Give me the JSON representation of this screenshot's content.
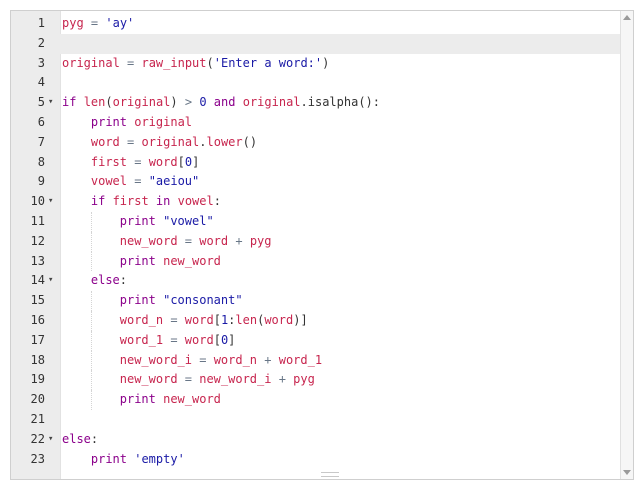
{
  "editor": {
    "language": "python",
    "active_line": 2,
    "colors": {
      "keyword": "#8b008b",
      "string": "#1a1aa6",
      "variable": "#c7254e",
      "gutter_bg": "#ececec"
    },
    "lines": [
      {
        "num": "1",
        "fold": "",
        "indent": 0,
        "tokens": [
          [
            "pyg",
            "var"
          ],
          [
            " = ",
            "op"
          ],
          [
            "'ay'",
            "str"
          ]
        ]
      },
      {
        "num": "2",
        "fold": "",
        "indent": 0,
        "tokens": []
      },
      {
        "num": "3",
        "fold": "",
        "indent": 0,
        "tokens": [
          [
            "original",
            "var"
          ],
          [
            " = ",
            "op"
          ],
          [
            "raw_input",
            "var"
          ],
          [
            "(",
            "plain"
          ],
          [
            "'Enter a word:'",
            "str"
          ],
          [
            ")",
            "plain"
          ]
        ]
      },
      {
        "num": "4",
        "fold": "",
        "indent": 0,
        "tokens": []
      },
      {
        "num": "5",
        "fold": "▾",
        "indent": 0,
        "tokens": [
          [
            "if",
            "kw"
          ],
          [
            " ",
            "plain"
          ],
          [
            "len",
            "var"
          ],
          [
            "(",
            "plain"
          ],
          [
            "original",
            "var"
          ],
          [
            ") ",
            "plain"
          ],
          [
            ">",
            "op"
          ],
          [
            " ",
            "plain"
          ],
          [
            "0",
            "num"
          ],
          [
            " ",
            "plain"
          ],
          [
            "and",
            "kw"
          ],
          [
            " ",
            "plain"
          ],
          [
            "original",
            "var"
          ],
          [
            ".isalpha():",
            "plain"
          ]
        ]
      },
      {
        "num": "6",
        "fold": "",
        "indent": 1,
        "tokens": [
          [
            "print",
            "kw"
          ],
          [
            " ",
            "plain"
          ],
          [
            "original",
            "var"
          ]
        ]
      },
      {
        "num": "7",
        "fold": "",
        "indent": 1,
        "tokens": [
          [
            "word",
            "var"
          ],
          [
            " = ",
            "op"
          ],
          [
            "original",
            "var"
          ],
          [
            ".",
            "plain"
          ],
          [
            "lower",
            "var"
          ],
          [
            "()",
            "plain"
          ]
        ]
      },
      {
        "num": "8",
        "fold": "",
        "indent": 1,
        "tokens": [
          [
            "first",
            "var"
          ],
          [
            " = ",
            "op"
          ],
          [
            "word",
            "var"
          ],
          [
            "[",
            "plain"
          ],
          [
            "0",
            "num"
          ],
          [
            "]",
            "plain"
          ]
        ]
      },
      {
        "num": "9",
        "fold": "",
        "indent": 1,
        "tokens": [
          [
            "vowel",
            "var"
          ],
          [
            " = ",
            "op"
          ],
          [
            "\"aeiou\"",
            "str"
          ]
        ]
      },
      {
        "num": "10",
        "fold": "▾",
        "indent": 1,
        "tokens": [
          [
            "if",
            "kw"
          ],
          [
            " ",
            "plain"
          ],
          [
            "first",
            "var"
          ],
          [
            " ",
            "plain"
          ],
          [
            "in",
            "kw"
          ],
          [
            " ",
            "plain"
          ],
          [
            "vowel",
            "var"
          ],
          [
            ":",
            "plain"
          ]
        ]
      },
      {
        "num": "11",
        "fold": "",
        "indent": 2,
        "tokens": [
          [
            "print",
            "kw"
          ],
          [
            " ",
            "plain"
          ],
          [
            "\"vowel\"",
            "str"
          ]
        ]
      },
      {
        "num": "12",
        "fold": "",
        "indent": 2,
        "tokens": [
          [
            "new_word",
            "var"
          ],
          [
            " = ",
            "op"
          ],
          [
            "word",
            "var"
          ],
          [
            " + ",
            "op"
          ],
          [
            "pyg",
            "var"
          ]
        ]
      },
      {
        "num": "13",
        "fold": "",
        "indent": 2,
        "tokens": [
          [
            "print",
            "kw"
          ],
          [
            " ",
            "plain"
          ],
          [
            "new_word",
            "var"
          ]
        ]
      },
      {
        "num": "14",
        "fold": "▾",
        "indent": 1,
        "tokens": [
          [
            "else",
            "kw"
          ],
          [
            ":",
            "plain"
          ]
        ]
      },
      {
        "num": "15",
        "fold": "",
        "indent": 2,
        "tokens": [
          [
            "print",
            "kw"
          ],
          [
            " ",
            "plain"
          ],
          [
            "\"consonant\"",
            "str"
          ]
        ]
      },
      {
        "num": "16",
        "fold": "",
        "indent": 2,
        "tokens": [
          [
            "word_n",
            "var"
          ],
          [
            " = ",
            "op"
          ],
          [
            "word",
            "var"
          ],
          [
            "[",
            "plain"
          ],
          [
            "1",
            "num"
          ],
          [
            ":",
            "plain"
          ],
          [
            "len",
            "var"
          ],
          [
            "(",
            "plain"
          ],
          [
            "word",
            "var"
          ],
          [
            ")]",
            "plain"
          ]
        ]
      },
      {
        "num": "17",
        "fold": "",
        "indent": 2,
        "tokens": [
          [
            "word_1",
            "var"
          ],
          [
            " = ",
            "op"
          ],
          [
            "word",
            "var"
          ],
          [
            "[",
            "plain"
          ],
          [
            "0",
            "num"
          ],
          [
            "]",
            "plain"
          ]
        ]
      },
      {
        "num": "18",
        "fold": "",
        "indent": 2,
        "tokens": [
          [
            "new_word_i",
            "var"
          ],
          [
            " = ",
            "op"
          ],
          [
            "word_n",
            "var"
          ],
          [
            " + ",
            "op"
          ],
          [
            "word_1",
            "var"
          ]
        ]
      },
      {
        "num": "19",
        "fold": "",
        "indent": 2,
        "tokens": [
          [
            "new_word",
            "var"
          ],
          [
            " = ",
            "op"
          ],
          [
            "new_word_i",
            "var"
          ],
          [
            " + ",
            "op"
          ],
          [
            "pyg",
            "var"
          ]
        ]
      },
      {
        "num": "20",
        "fold": "",
        "indent": 2,
        "tokens": [
          [
            "print",
            "kw"
          ],
          [
            " ",
            "plain"
          ],
          [
            "new_word",
            "var"
          ]
        ]
      },
      {
        "num": "21",
        "fold": "",
        "indent": 0,
        "tokens": []
      },
      {
        "num": "22",
        "fold": "▾",
        "indent": 0,
        "tokens": [
          [
            "else",
            "kw"
          ],
          [
            ":",
            "plain"
          ]
        ]
      },
      {
        "num": "23",
        "fold": "",
        "indent": 1,
        "tokens": [
          [
            "print",
            "kw"
          ],
          [
            " ",
            "plain"
          ],
          [
            "'empty'",
            "str"
          ]
        ]
      }
    ]
  },
  "scrollbar": {
    "up_icon": "arrow-up-icon",
    "down_icon": "arrow-down-icon"
  }
}
